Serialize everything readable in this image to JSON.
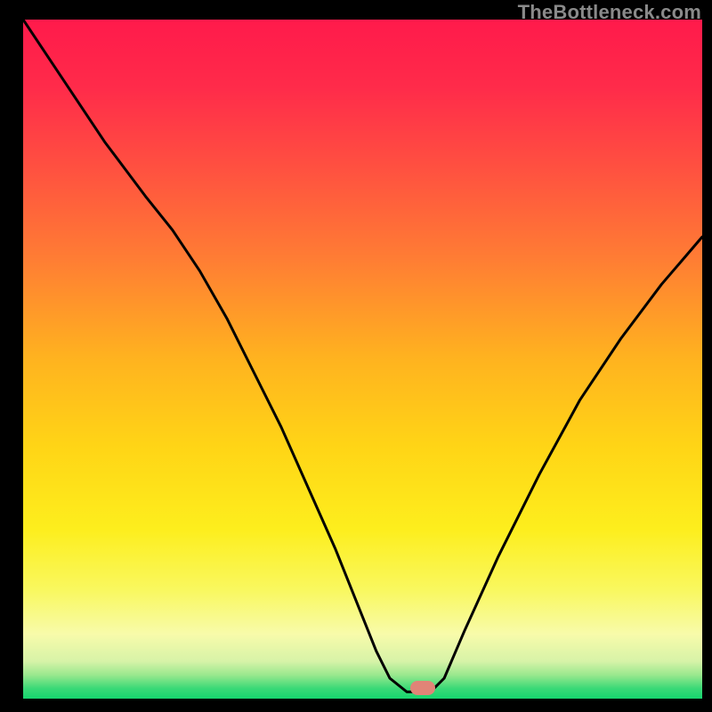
{
  "watermark": "TheBottleneck.com",
  "gradient_stops": [
    {
      "offset": 0.0,
      "color": "#ff1a4b"
    },
    {
      "offset": 0.1,
      "color": "#ff2b4a"
    },
    {
      "offset": 0.22,
      "color": "#ff5140"
    },
    {
      "offset": 0.35,
      "color": "#ff7c34"
    },
    {
      "offset": 0.5,
      "color": "#ffb31f"
    },
    {
      "offset": 0.63,
      "color": "#ffd516"
    },
    {
      "offset": 0.75,
      "color": "#fdee1d"
    },
    {
      "offset": 0.84,
      "color": "#f9f85f"
    },
    {
      "offset": 0.905,
      "color": "#f8fbaa"
    },
    {
      "offset": 0.945,
      "color": "#d7f3a8"
    },
    {
      "offset": 0.965,
      "color": "#9ae88e"
    },
    {
      "offset": 0.985,
      "color": "#3ad977"
    },
    {
      "offset": 1.0,
      "color": "#16d46e"
    }
  ],
  "chart_data": {
    "type": "line",
    "title": "",
    "xlabel": "",
    "ylabel": "",
    "xlim": [
      0,
      100
    ],
    "ylim": [
      0,
      100
    ],
    "series": [
      {
        "name": "bottleneck-curve",
        "x": [
          0,
          6,
          12,
          18,
          22,
          26,
          30,
          34,
          38,
          42,
          46,
          50,
          52,
          54,
          56.5,
          60,
          62,
          65,
          70,
          76,
          82,
          88,
          94,
          100
        ],
        "values": [
          100,
          91,
          82,
          74,
          69,
          63,
          56,
          48,
          40,
          31,
          22,
          12,
          7,
          3,
          1,
          1,
          3,
          10,
          21,
          33,
          44,
          53,
          61,
          68
        ]
      }
    ],
    "marker": {
      "x": 58.8,
      "y": 1.6
    },
    "legend": false,
    "grid": false
  }
}
